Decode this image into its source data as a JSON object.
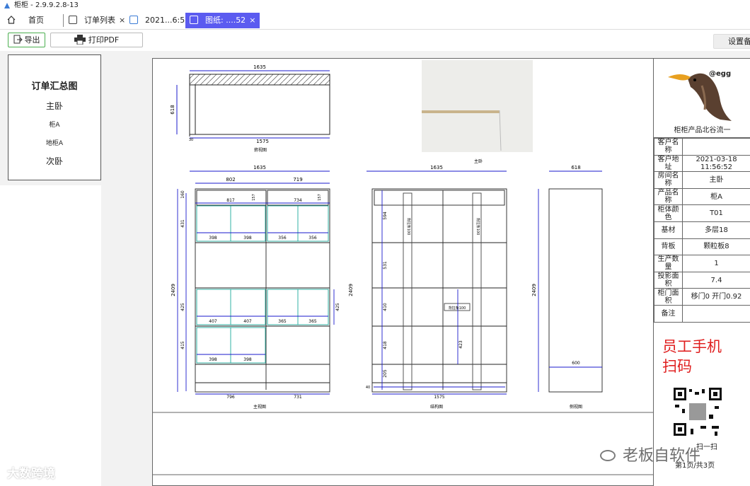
{
  "window": {
    "title": "柜柜 - 2.9.9.2.8-13"
  },
  "tabs": [
    {
      "label": "首页"
    },
    {
      "label": "订单列表"
    },
    {
      "label": "2021...6:52"
    },
    {
      "label": "图纸: ....52"
    }
  ],
  "toolbar": {
    "export_label": "导出",
    "print_pdf_label": "打印PDF",
    "settings_label": "设置备"
  },
  "outline": {
    "title": "订单汇总图",
    "room1": "主卧",
    "cabinet1": "柜A",
    "cabinet2": "地柜A",
    "room2": "次卧"
  },
  "drawing": {
    "top_view": {
      "width_top": "1635",
      "depth": "618",
      "width_bottom": "1575",
      "small": "30",
      "caption": "俯视图"
    },
    "room_label": "主卧",
    "front_view": {
      "width": "1635",
      "top_left": "802",
      "top_right": "719",
      "height": "2409",
      "caption": "主视图",
      "bottom_left": "796",
      "bottom_right": "731",
      "left_dims": [
        "160",
        "431",
        "425",
        "415"
      ],
      "right_dim": "425",
      "row1": [
        "817",
        "734"
      ],
      "row2": [
        "398",
        "398",
        "356",
        "356"
      ],
      "row3": [
        "407",
        "407",
        "365",
        "365"
      ],
      "row4": [
        "398",
        "398"
      ],
      "small_a": "157",
      "small_b": "157"
    },
    "struct_view": {
      "width": "1635",
      "height": "2409",
      "bottom": "1575",
      "caption": "结构图",
      "left_dims": [
        "594",
        "531",
        "410",
        "418",
        "205"
      ],
      "mid_dim": "423",
      "label_box": "背拉条100",
      "strip_label": "背拉条100",
      "small": "40"
    },
    "side_view": {
      "width": "618",
      "height": "2409",
      "bottom": "600",
      "caption": "侧视图"
    }
  },
  "info": {
    "logo_tag": "@egg",
    "logo_caption": "柜柜产品北谷流一",
    "rows": [
      {
        "label": "客户名称",
        "value": ""
      },
      {
        "label": "客户地址",
        "value": "2021-03-18 11:56:52"
      },
      {
        "label": "房间名称",
        "value": "主卧"
      },
      {
        "label": "产品名称",
        "value": "柜A"
      },
      {
        "label": "柜体颜色",
        "value": "T01"
      },
      {
        "label": "基材",
        "value": "多层18"
      },
      {
        "label": "背板",
        "value": "颗粒板8"
      },
      {
        "label": "生产数量",
        "value": "1"
      },
      {
        "label": "投影面积",
        "value": "7.4"
      },
      {
        "label": "柜门面积",
        "value": "移门0 开门0.92"
      },
      {
        "label": "备注",
        "value": ""
      }
    ],
    "staff_scan": "员工手机扫码",
    "qr_label": "扫一扫",
    "page_no": "第1页/共3页"
  },
  "watermarks": {
    "left": "大数跨境",
    "right": "老板自软件"
  },
  "colors": {
    "tab_active": "#5b5bf0",
    "dim_line": "#1a1acc",
    "door_line": "#1aa89a",
    "red_text": "#e02020"
  }
}
